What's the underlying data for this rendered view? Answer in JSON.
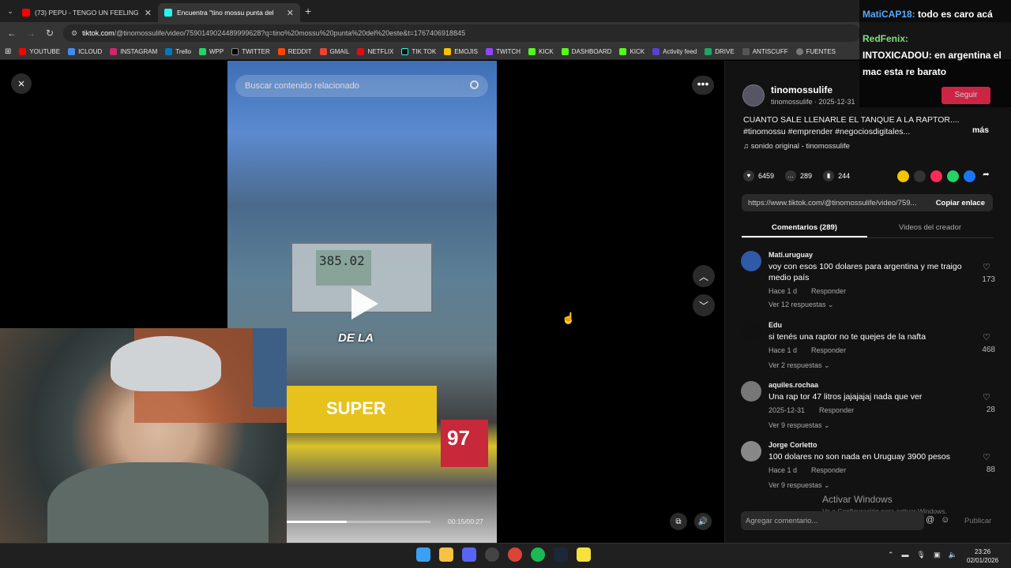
{
  "browser": {
    "tabs": [
      {
        "title": "(73) PEPU - TENGO UN FEELING",
        "color": "#ff0000",
        "active": false
      },
      {
        "title": "Encuentra \"tino mossu punta del",
        "color": "#25f4ee",
        "active": true
      }
    ],
    "url_domain": "tiktok.com",
    "url_path": "/@tinomossulife/video/7590149024489999628?q=tino%20mossu%20punta%20del%20este&t=1767406918845",
    "bookmarks": [
      "YOUTUBE",
      "ICLOUD",
      "INSTAGRAM",
      "Trello",
      "WPP",
      "TWITTER",
      "REDDIT",
      "GMAIL",
      "NETFLIX",
      "TIK TOK",
      "EMOJIS",
      "TWITCH",
      "KICK",
      "DASHBOARD",
      "KICK",
      "Activity feed",
      "DRIVE",
      "ANTISCUFF",
      "FUENTES"
    ],
    "new_tab": "+"
  },
  "viewer": {
    "close": "×",
    "search_placeholder": "Buscar contenido relacionado",
    "video_caption": "DE LA",
    "pump_reading": "385.02",
    "brand_label": "SUPER",
    "octane_label": "97",
    "time": "00:15/00:27",
    "progress": 0.42,
    "more": "•••"
  },
  "post": {
    "display_name": "tinomossulife",
    "handle_date": "tinomossulife · 2025-12-31",
    "description": "CUANTO SALE LLENARLE EL TANQUE A LA RAPTOR.... #tinomossu #emprender #negociosdigitales...",
    "more_label": "más",
    "sound": "♫  sonido original - tinomossulife",
    "likes": "6459",
    "comments": "289",
    "saves": "244",
    "link": "https://www.tiktok.com/@tinomossulife/video/759...",
    "copy_label": "Copiar enlace",
    "tab_comments": "Comentarios (289)",
    "tab_videos": "Videos del creador"
  },
  "comments": [
    {
      "user": "Mati.uruguay",
      "text": "voy con esos 100 dolares para argentina y me traigo medio país",
      "time": "Hace 1 d",
      "reply": "Responder",
      "replies": "Ver 12 respuestas ⌄",
      "likes": "173"
    },
    {
      "user": "Edu",
      "text": "si tenés una raptor no te quejes de la nafta",
      "time": "Hace 1 d",
      "reply": "Responder",
      "replies": "Ver 2 respuestas ⌄",
      "likes": "468"
    },
    {
      "user": "aquiles.rochaa",
      "text": "Una rap tor 47 litros jajajajaj nada que ver",
      "time": "2025-12-31",
      "reply": "Responder",
      "replies": "Ver 9 respuestas ⌄",
      "likes": "28"
    },
    {
      "user": "Jorge Corletto",
      "text": "100 dolares no son nada en Uruguay 3900 pesos",
      "time": "Hace 1 d",
      "reply": "Responder",
      "replies": "Ver 9 respuestas ⌄",
      "likes": "88"
    }
  ],
  "footer": {
    "add_comment": "Agregar comentario...",
    "publish": "Publicar",
    "activate_title": "Activar Windows",
    "activate_sub": "Ve a Configuración para activar Windows."
  },
  "chat": {
    "lines": [
      {
        "user": "MatiCAP18:",
        "msg": "todo es caro acá"
      },
      {
        "user": "RedFenix:",
        "msg": ""
      },
      {
        "user": "INTOXICADOU:",
        "msg": "en argentina el mac esta re barato"
      }
    ],
    "follow": "Seguir"
  },
  "taskbar": {
    "time": "23:26",
    "date": "02/01/2026"
  }
}
